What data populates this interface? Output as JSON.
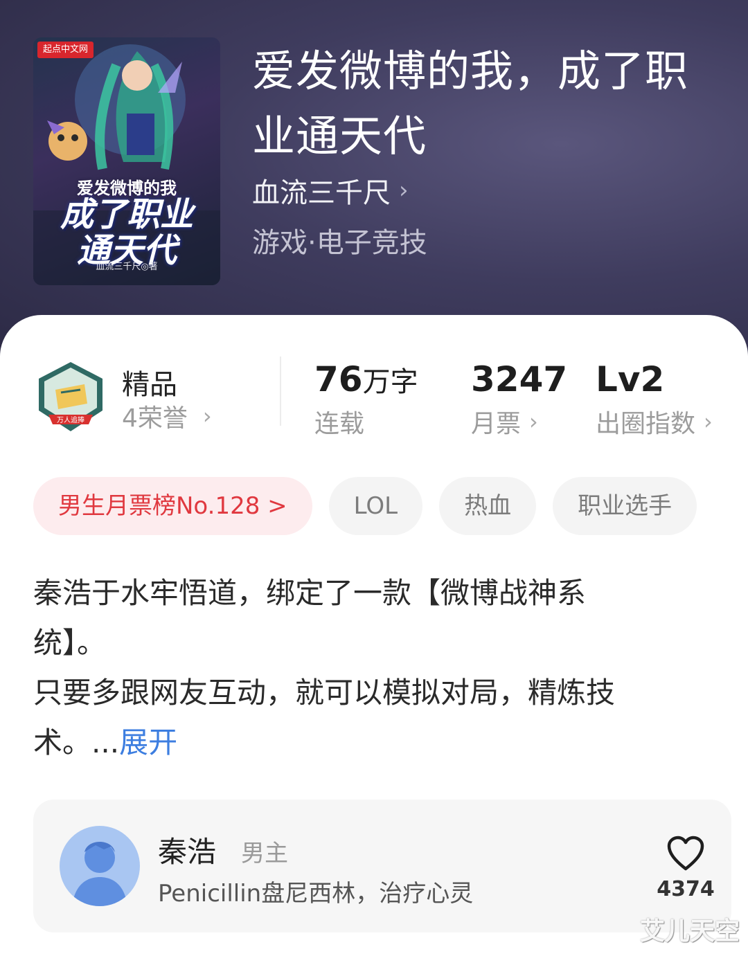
{
  "cover": {
    "badge": "起点中文网",
    "subtitle": "爱发微博的我",
    "title_line1": "成了职业",
    "title_line2": "通天代",
    "author_credit": "血流三千尺◎著"
  },
  "book": {
    "title": "爱发微博的我，成了职业通天代",
    "author": "血流三千尺",
    "genre": "游戏·电子竞技"
  },
  "stats": {
    "quality_label": "精品",
    "honors": "4荣誉",
    "emblem_text": "万人追捧",
    "words_num": "76",
    "words_unit": "万字",
    "words_status": "连载",
    "monthly_votes": "3247",
    "monthly_votes_label": "月票",
    "breakout_level": "Lv2",
    "breakout_label": "出圈指数"
  },
  "tags": [
    "男生月票榜No.128 >",
    "LOL",
    "热血",
    "职业选手"
  ],
  "description": {
    "line1": "秦浩于水牢悟道，绑定了一款【微博战神系",
    "line2": "统】。",
    "line3": "只要多跟网友互动，就可以模拟对局，精炼技",
    "line4": "术。...",
    "expand": "展开"
  },
  "character": {
    "name": "秦浩",
    "role": "男主",
    "description": "Penicillin盘尼西林，治疗心灵",
    "likes": "4374"
  },
  "watermark": "艾儿天空",
  "colors": {
    "hero_bg": "#3f3c5e",
    "rank_tag_text": "#e0383f",
    "rank_tag_bg": "#fdecee",
    "expand_link": "#3d7ee0"
  }
}
